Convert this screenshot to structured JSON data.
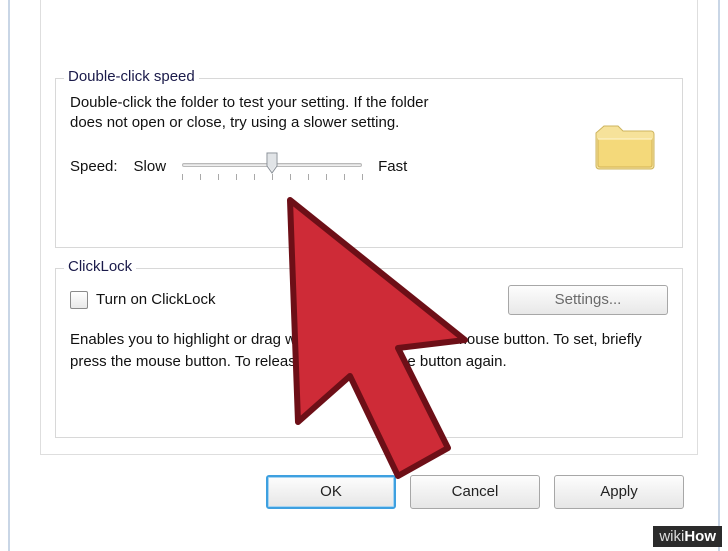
{
  "groups": {
    "speed": {
      "legend": "Double-click speed",
      "help": "Double-click the folder to test your setting. If the folder does not open or close, try using a slower setting.",
      "label_speed": "Speed:",
      "label_slow": "Slow",
      "label_fast": "Fast",
      "slider_value": 5,
      "slider_min": 0,
      "slider_max": 10
    },
    "clicklock": {
      "legend": "ClickLock",
      "checkbox_label": "Turn on ClickLock",
      "checkbox_checked": false,
      "settings_button": "Settings...",
      "description": "Enables you to highlight or drag without holding down the mouse button. To set, briefly press the mouse button. To release, click the mouse button again."
    }
  },
  "buttons": {
    "ok": "OK",
    "cancel": "Cancel",
    "apply": "Apply"
  },
  "watermark": {
    "prefix": "wiki",
    "suffix": "How"
  },
  "icons": {
    "folder": "folder-icon",
    "slider_thumb": "slider-thumb-icon",
    "cursor": "cursor-pointer-icon"
  },
  "colors": {
    "accent_blue": "#3ea0e0",
    "cursor_red": "#ce2b37",
    "folder_yellow": "#f4d97a"
  }
}
